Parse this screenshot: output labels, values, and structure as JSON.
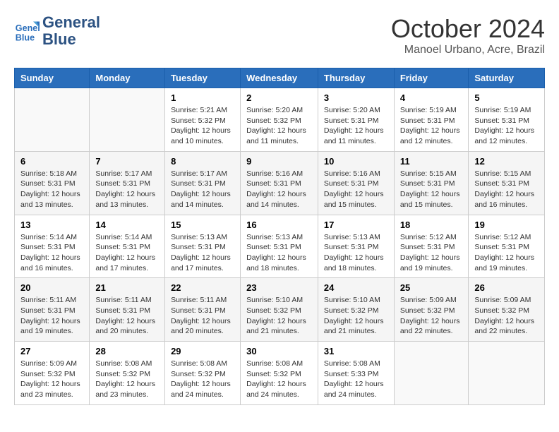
{
  "header": {
    "logo_line1": "General",
    "logo_line2": "Blue",
    "month": "October 2024",
    "location": "Manoel Urbano, Acre, Brazil"
  },
  "weekdays": [
    "Sunday",
    "Monday",
    "Tuesday",
    "Wednesday",
    "Thursday",
    "Friday",
    "Saturday"
  ],
  "weeks": [
    [
      {
        "day": "",
        "sunrise": "",
        "sunset": "",
        "daylight": ""
      },
      {
        "day": "",
        "sunrise": "",
        "sunset": "",
        "daylight": ""
      },
      {
        "day": "1",
        "sunrise": "Sunrise: 5:21 AM",
        "sunset": "Sunset: 5:32 PM",
        "daylight": "Daylight: 12 hours and 10 minutes."
      },
      {
        "day": "2",
        "sunrise": "Sunrise: 5:20 AM",
        "sunset": "Sunset: 5:32 PM",
        "daylight": "Daylight: 12 hours and 11 minutes."
      },
      {
        "day": "3",
        "sunrise": "Sunrise: 5:20 AM",
        "sunset": "Sunset: 5:31 PM",
        "daylight": "Daylight: 12 hours and 11 minutes."
      },
      {
        "day": "4",
        "sunrise": "Sunrise: 5:19 AM",
        "sunset": "Sunset: 5:31 PM",
        "daylight": "Daylight: 12 hours and 12 minutes."
      },
      {
        "day": "5",
        "sunrise": "Sunrise: 5:19 AM",
        "sunset": "Sunset: 5:31 PM",
        "daylight": "Daylight: 12 hours and 12 minutes."
      }
    ],
    [
      {
        "day": "6",
        "sunrise": "Sunrise: 5:18 AM",
        "sunset": "Sunset: 5:31 PM",
        "daylight": "Daylight: 12 hours and 13 minutes."
      },
      {
        "day": "7",
        "sunrise": "Sunrise: 5:17 AM",
        "sunset": "Sunset: 5:31 PM",
        "daylight": "Daylight: 12 hours and 13 minutes."
      },
      {
        "day": "8",
        "sunrise": "Sunrise: 5:17 AM",
        "sunset": "Sunset: 5:31 PM",
        "daylight": "Daylight: 12 hours and 14 minutes."
      },
      {
        "day": "9",
        "sunrise": "Sunrise: 5:16 AM",
        "sunset": "Sunset: 5:31 PM",
        "daylight": "Daylight: 12 hours and 14 minutes."
      },
      {
        "day": "10",
        "sunrise": "Sunrise: 5:16 AM",
        "sunset": "Sunset: 5:31 PM",
        "daylight": "Daylight: 12 hours and 15 minutes."
      },
      {
        "day": "11",
        "sunrise": "Sunrise: 5:15 AM",
        "sunset": "Sunset: 5:31 PM",
        "daylight": "Daylight: 12 hours and 15 minutes."
      },
      {
        "day": "12",
        "sunrise": "Sunrise: 5:15 AM",
        "sunset": "Sunset: 5:31 PM",
        "daylight": "Daylight: 12 hours and 16 minutes."
      }
    ],
    [
      {
        "day": "13",
        "sunrise": "Sunrise: 5:14 AM",
        "sunset": "Sunset: 5:31 PM",
        "daylight": "Daylight: 12 hours and 16 minutes."
      },
      {
        "day": "14",
        "sunrise": "Sunrise: 5:14 AM",
        "sunset": "Sunset: 5:31 PM",
        "daylight": "Daylight: 12 hours and 17 minutes."
      },
      {
        "day": "15",
        "sunrise": "Sunrise: 5:13 AM",
        "sunset": "Sunset: 5:31 PM",
        "daylight": "Daylight: 12 hours and 17 minutes."
      },
      {
        "day": "16",
        "sunrise": "Sunrise: 5:13 AM",
        "sunset": "Sunset: 5:31 PM",
        "daylight": "Daylight: 12 hours and 18 minutes."
      },
      {
        "day": "17",
        "sunrise": "Sunrise: 5:13 AM",
        "sunset": "Sunset: 5:31 PM",
        "daylight": "Daylight: 12 hours and 18 minutes."
      },
      {
        "day": "18",
        "sunrise": "Sunrise: 5:12 AM",
        "sunset": "Sunset: 5:31 PM",
        "daylight": "Daylight: 12 hours and 19 minutes."
      },
      {
        "day": "19",
        "sunrise": "Sunrise: 5:12 AM",
        "sunset": "Sunset: 5:31 PM",
        "daylight": "Daylight: 12 hours and 19 minutes."
      }
    ],
    [
      {
        "day": "20",
        "sunrise": "Sunrise: 5:11 AM",
        "sunset": "Sunset: 5:31 PM",
        "daylight": "Daylight: 12 hours and 19 minutes."
      },
      {
        "day": "21",
        "sunrise": "Sunrise: 5:11 AM",
        "sunset": "Sunset: 5:31 PM",
        "daylight": "Daylight: 12 hours and 20 minutes."
      },
      {
        "day": "22",
        "sunrise": "Sunrise: 5:11 AM",
        "sunset": "Sunset: 5:31 PM",
        "daylight": "Daylight: 12 hours and 20 minutes."
      },
      {
        "day": "23",
        "sunrise": "Sunrise: 5:10 AM",
        "sunset": "Sunset: 5:32 PM",
        "daylight": "Daylight: 12 hours and 21 minutes."
      },
      {
        "day": "24",
        "sunrise": "Sunrise: 5:10 AM",
        "sunset": "Sunset: 5:32 PM",
        "daylight": "Daylight: 12 hours and 21 minutes."
      },
      {
        "day": "25",
        "sunrise": "Sunrise: 5:09 AM",
        "sunset": "Sunset: 5:32 PM",
        "daylight": "Daylight: 12 hours and 22 minutes."
      },
      {
        "day": "26",
        "sunrise": "Sunrise: 5:09 AM",
        "sunset": "Sunset: 5:32 PM",
        "daylight": "Daylight: 12 hours and 22 minutes."
      }
    ],
    [
      {
        "day": "27",
        "sunrise": "Sunrise: 5:09 AM",
        "sunset": "Sunset: 5:32 PM",
        "daylight": "Daylight: 12 hours and 23 minutes."
      },
      {
        "day": "28",
        "sunrise": "Sunrise: 5:08 AM",
        "sunset": "Sunset: 5:32 PM",
        "daylight": "Daylight: 12 hours and 23 minutes."
      },
      {
        "day": "29",
        "sunrise": "Sunrise: 5:08 AM",
        "sunset": "Sunset: 5:32 PM",
        "daylight": "Daylight: 12 hours and 24 minutes."
      },
      {
        "day": "30",
        "sunrise": "Sunrise: 5:08 AM",
        "sunset": "Sunset: 5:32 PM",
        "daylight": "Daylight: 12 hours and 24 minutes."
      },
      {
        "day": "31",
        "sunrise": "Sunrise: 5:08 AM",
        "sunset": "Sunset: 5:33 PM",
        "daylight": "Daylight: 12 hours and 24 minutes."
      },
      {
        "day": "",
        "sunrise": "",
        "sunset": "",
        "daylight": ""
      },
      {
        "day": "",
        "sunrise": "",
        "sunset": "",
        "daylight": ""
      }
    ]
  ]
}
